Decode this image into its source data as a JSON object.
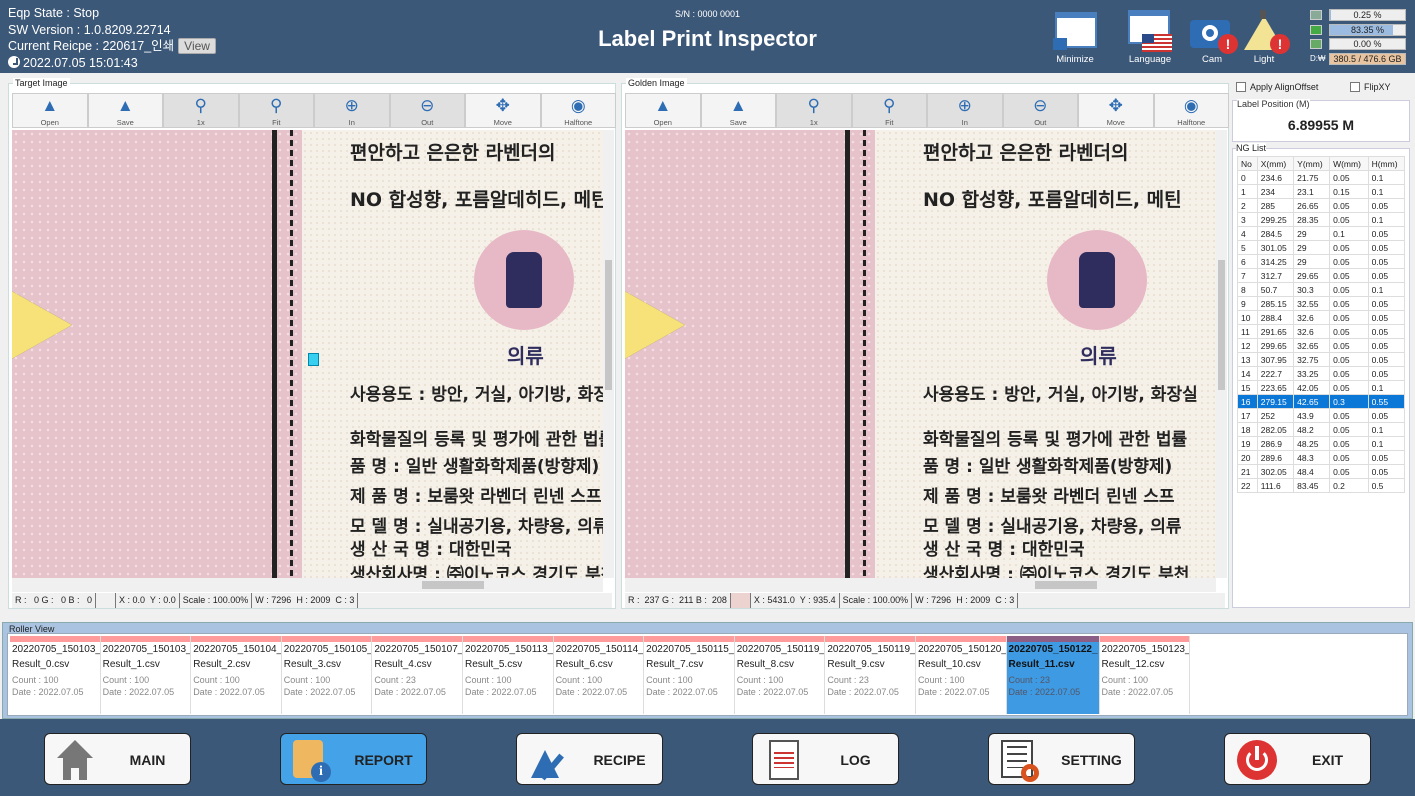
{
  "header": {
    "eqp_state": "Eqp State : Stop",
    "sw_version": "SW Version : 1.0.8209.22714",
    "current_recipe": "Current Reicpe : 220617_인쇄",
    "view_button": "View",
    "datetime": "2022.07.05 15:01:43",
    "serial": "S/N : 0000 0001",
    "title": "Label Print Inspector",
    "icons": [
      {
        "name": "minimize-icon",
        "label": "Minimize"
      },
      {
        "name": "language-icon",
        "label": "Language"
      },
      {
        "name": "camera-icon",
        "label": "Cam"
      },
      {
        "name": "light-icon",
        "label": "Light"
      }
    ],
    "system": {
      "cpu": "0.25 %",
      "cpu_fraction": 0.0025,
      "memory": "83.35 %",
      "memory_fraction": 0.8335,
      "gpu": "0.00 %",
      "gpu_fraction": 0,
      "disk_label": "D:₩",
      "disk": "380.5 / 476.6 GB"
    }
  },
  "toolbar": [
    "Open",
    "Save",
    "1x",
    "Fit",
    "In",
    "Out",
    "Move",
    "Halftone"
  ],
  "target": {
    "title": "Target Image",
    "status": {
      "rgb": "R :   0 G :   0 B :   0",
      "xy": "X : 0.0  Y : 0.0",
      "scale": "Scale : 100.00%",
      "size": "W : 7296  H : 2009  C : 3"
    }
  },
  "golden": {
    "title": "Golden Image",
    "status": {
      "rgb": "R :  237 G :  211 B :  208",
      "swatch_color": "#edd3d0",
      "xy": "X : 5431.0  Y : 935.4",
      "scale": "Scale : 100.00%",
      "size": "W : 7296  H : 2009  C : 3"
    }
  },
  "label_text": [
    "편안하고 은은한 라벤더의",
    "NO 합성향, 포름알데히드, 메틴",
    "의류",
    "사용용도 : 방안, 거실, 아기방, 화장실",
    "화학물질의 등록 및 평가에 관한 법률",
    "품       명 : 일반 생활화학제품(방향제)",
    "제  품  명 : 보룸왓 라벤더 린넨 스프",
    "모  델  명 : 실내공기용, 차량용, 의류",
    "생 산 국 명 : 대한민국",
    "생산회사명 : ㈜이노코스  경기도 부천"
  ],
  "right": {
    "apply_align": "Apply AlignOffset",
    "flip": "FlipXY",
    "label_position_title": "Label Position (M)",
    "label_position": "6.89955 M",
    "ng_title": "NG List",
    "columns": [
      "No",
      "X(mm)",
      "Y(mm)",
      "W(mm)",
      "H(mm)"
    ],
    "rows": [
      [
        "0",
        "234.6",
        "21.75",
        "0.05",
        "0.1"
      ],
      [
        "1",
        "234",
        "23.1",
        "0.15",
        "0.1"
      ],
      [
        "2",
        "285",
        "26.65",
        "0.05",
        "0.05"
      ],
      [
        "3",
        "299.25",
        "28.35",
        "0.05",
        "0.1"
      ],
      [
        "4",
        "284.5",
        "29",
        "0.1",
        "0.05"
      ],
      [
        "5",
        "301.05",
        "29",
        "0.05",
        "0.05"
      ],
      [
        "6",
        "314.25",
        "29",
        "0.05",
        "0.05"
      ],
      [
        "7",
        "312.7",
        "29.65",
        "0.05",
        "0.05"
      ],
      [
        "8",
        "50.7",
        "30.3",
        "0.05",
        "0.1"
      ],
      [
        "9",
        "285.15",
        "32.55",
        "0.05",
        "0.05"
      ],
      [
        "10",
        "288.4",
        "32.6",
        "0.05",
        "0.05"
      ],
      [
        "11",
        "291.65",
        "32.6",
        "0.05",
        "0.05"
      ],
      [
        "12",
        "299.65",
        "32.65",
        "0.05",
        "0.05"
      ],
      [
        "13",
        "307.95",
        "32.75",
        "0.05",
        "0.05"
      ],
      [
        "14",
        "222.7",
        "33.25",
        "0.05",
        "0.05"
      ],
      [
        "15",
        "223.65",
        "42.05",
        "0.05",
        "0.1"
      ],
      [
        "16",
        "279.15",
        "42.65",
        "0.3",
        "0.55"
      ],
      [
        "17",
        "252",
        "43.9",
        "0.05",
        "0.05"
      ],
      [
        "18",
        "282.05",
        "48.2",
        "0.05",
        "0.1"
      ],
      [
        "19",
        "286.9",
        "48.25",
        "0.05",
        "0.1"
      ],
      [
        "20",
        "289.6",
        "48.3",
        "0.05",
        "0.05"
      ],
      [
        "21",
        "302.05",
        "48.4",
        "0.05",
        "0.05"
      ],
      [
        "22",
        "111.6",
        "83.45",
        "0.2",
        "0.5"
      ]
    ],
    "selected_row": 16
  },
  "roller": {
    "title": "Roller View",
    "selected": 11,
    "items": [
      {
        "id": "20220705_150103_",
        "file": "Result_0.csv",
        "count": "Count : 100",
        "date": "Date : 2022.07.05"
      },
      {
        "id": "20220705_150103_",
        "file": "Result_1.csv",
        "count": "Count : 100",
        "date": "Date : 2022.07.05"
      },
      {
        "id": "20220705_150104_",
        "file": "Result_2.csv",
        "count": "Count : 100",
        "date": "Date : 2022.07.05"
      },
      {
        "id": "20220705_150105_",
        "file": "Result_3.csv",
        "count": "Count : 100",
        "date": "Date : 2022.07.05"
      },
      {
        "id": "20220705_150107_",
        "file": "Result_4.csv",
        "count": "Count : 23",
        "date": "Date : 2022.07.05"
      },
      {
        "id": "20220705_150113_",
        "file": "Result_5.csv",
        "count": "Count : 100",
        "date": "Date : 2022.07.05"
      },
      {
        "id": "20220705_150114_",
        "file": "Result_6.csv",
        "count": "Count : 100",
        "date": "Date : 2022.07.05"
      },
      {
        "id": "20220705_150115_",
        "file": "Result_7.csv",
        "count": "Count : 100",
        "date": "Date : 2022.07.05"
      },
      {
        "id": "20220705_150119_",
        "file": "Result_8.csv",
        "count": "Count : 100",
        "date": "Date : 2022.07.05"
      },
      {
        "id": "20220705_150119_",
        "file": "Result_9.csv",
        "count": "Count : 23",
        "date": "Date : 2022.07.05"
      },
      {
        "id": "20220705_150120_",
        "file": "Result_10.csv",
        "count": "Count : 100",
        "date": "Date : 2022.07.05"
      },
      {
        "id": "20220705_150122_",
        "file": "Result_11.csv",
        "count": "Count : 23",
        "date": "Date : 2022.07.05"
      },
      {
        "id": "20220705_150123_",
        "file": "Result_12.csv",
        "count": "Count : 100",
        "date": "Date : 2022.07.05"
      }
    ]
  },
  "nav": [
    {
      "label": "MAIN",
      "icon": "home-icon"
    },
    {
      "label": "REPORT",
      "icon": "report-icon",
      "active": true
    },
    {
      "label": "RECIPE",
      "icon": "recipe-flask-icon"
    },
    {
      "label": "LOG",
      "icon": "log-document-icon"
    },
    {
      "label": "SETTING",
      "icon": "setting-checklist-icon"
    },
    {
      "label": "EXIT",
      "icon": "power-icon"
    }
  ]
}
